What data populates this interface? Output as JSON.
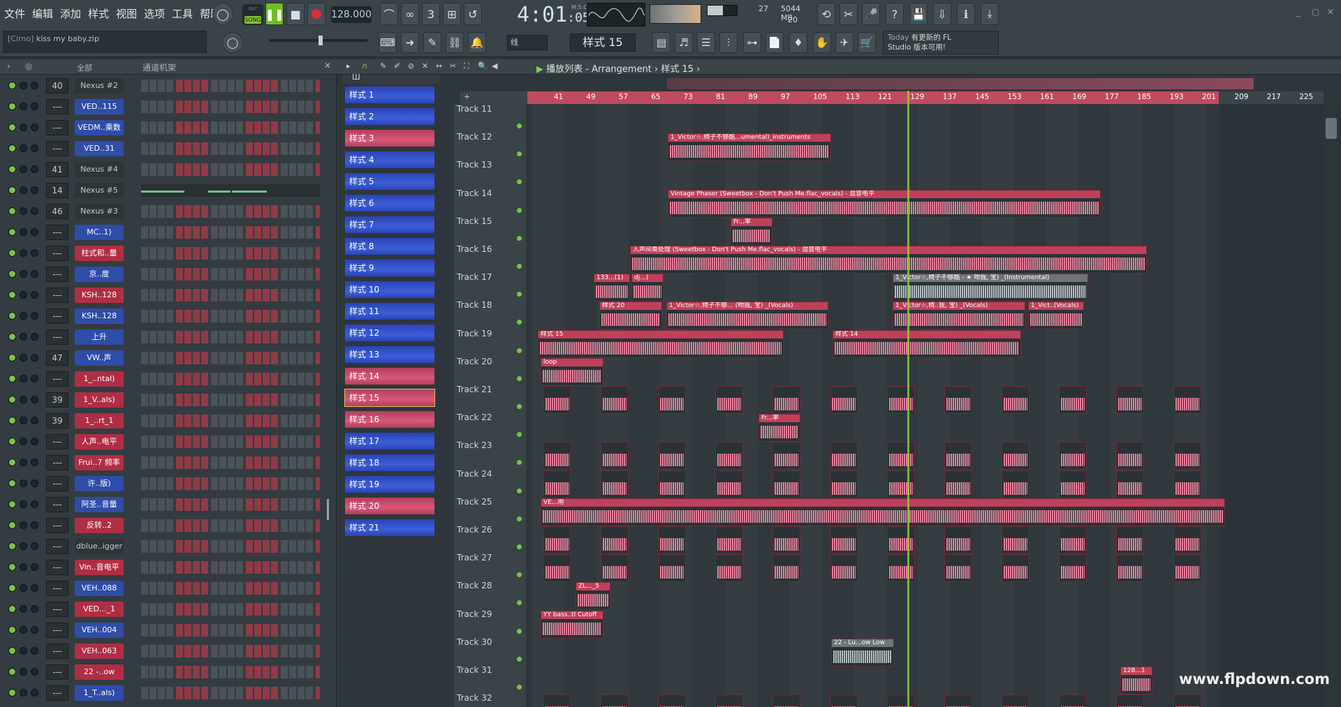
{
  "menu": [
    "文件",
    "编辑",
    "添加",
    "样式",
    "视图",
    "选项",
    "工具",
    "帮助"
  ],
  "transport": {
    "pat_label": "PAT",
    "song_label": "SONG",
    "tempo": "128.000",
    "time": "4:01",
    "time_sub": ":05",
    "time_label": "M:S:CS",
    "cpu_label": "5044 MB",
    "cpu_value": "27",
    "voices": "20"
  },
  "hint": {
    "prefix": "[Cirno]",
    "text": "kiss my baby.zip"
  },
  "news": {
    "today": "Today",
    "line1": "有更新的 FL",
    "line2": "Studio 版本可用!"
  },
  "snap_label": "线",
  "pattern_selector": "样式 15",
  "channel_rack": {
    "filter": "全部",
    "title": "通道机架"
  },
  "channels": [
    {
      "num": "40",
      "name": "Nexus #2",
      "color": "dark"
    },
    {
      "num": "---",
      "name": "VED..115",
      "color": "blue"
    },
    {
      "num": "---",
      "name": "VEDM..乘数",
      "color": "blue"
    },
    {
      "num": "---",
      "name": "VED..31",
      "color": "blue"
    },
    {
      "num": "41",
      "name": "Nexus #4",
      "color": "dark"
    },
    {
      "num": "14",
      "name": "Nexus #5",
      "color": "dark"
    },
    {
      "num": "46",
      "name": "Nexus #3",
      "color": "dark"
    },
    {
      "num": "---",
      "name": "MC..1)",
      "color": "blue"
    },
    {
      "num": "---",
      "name": "柱式和..量",
      "color": "red"
    },
    {
      "num": "---",
      "name": "京..度",
      "color": "blue"
    },
    {
      "num": "---",
      "name": "KSH..128",
      "color": "red"
    },
    {
      "num": "---",
      "name": "KSH..128",
      "color": "blue"
    },
    {
      "num": "---",
      "name": "上升",
      "color": "blue"
    },
    {
      "num": "47",
      "name": "VW..声",
      "color": "blue"
    },
    {
      "num": "---",
      "name": "1_..ntal)",
      "color": "red"
    },
    {
      "num": "39",
      "name": "1_V..als)",
      "color": "red"
    },
    {
      "num": "39",
      "name": "1_..rt_1",
      "color": "red"
    },
    {
      "num": "---",
      "name": "人声..电平",
      "color": "red"
    },
    {
      "num": "---",
      "name": "Frui..7 频率",
      "color": "red"
    },
    {
      "num": "---",
      "name": "许..版)",
      "color": "blue"
    },
    {
      "num": "---",
      "name": "阿圣..音量",
      "color": "blue"
    },
    {
      "num": "---",
      "name": "反转..2",
      "color": "red"
    },
    {
      "num": "---",
      "name": "dblue..igger",
      "color": "dark"
    },
    {
      "num": "---",
      "name": "Vin..音电平",
      "color": "red"
    },
    {
      "num": "---",
      "name": "VEH..088",
      "color": "blue"
    },
    {
      "num": "---",
      "name": "VED..._1",
      "color": "red"
    },
    {
      "num": "---",
      "name": "VEH..004",
      "color": "blue"
    },
    {
      "num": "---",
      "name": "VEH..063",
      "color": "red"
    },
    {
      "num": "---",
      "name": "22 -..ow",
      "color": "red"
    },
    {
      "num": "---",
      "name": "1_T..als)",
      "color": "blue"
    }
  ],
  "patterns": [
    {
      "label": "样式 1",
      "color": "blue"
    },
    {
      "label": "样式 2",
      "color": "blue"
    },
    {
      "label": "样式 3",
      "color": "red"
    },
    {
      "label": "样式 4",
      "color": "blue"
    },
    {
      "label": "样式 5",
      "color": "blue"
    },
    {
      "label": "样式 6",
      "color": "blue"
    },
    {
      "label": "样式 7",
      "color": "blue"
    },
    {
      "label": "样式 8",
      "color": "blue"
    },
    {
      "label": "样式 9",
      "color": "blue"
    },
    {
      "label": "样式 10",
      "color": "blue"
    },
    {
      "label": "样式 11",
      "color": "blue"
    },
    {
      "label": "样式 12",
      "color": "blue"
    },
    {
      "label": "样式 13",
      "color": "blue"
    },
    {
      "label": "样式 14",
      "color": "red"
    },
    {
      "label": "样式 15",
      "color": "red"
    },
    {
      "label": "样式 16",
      "color": "red"
    },
    {
      "label": "样式 17",
      "color": "blue"
    },
    {
      "label": "样式 18",
      "color": "blue"
    },
    {
      "label": "样式 19",
      "color": "blue"
    },
    {
      "label": "样式 20",
      "color": "red"
    },
    {
      "label": "样式 21",
      "color": "blue"
    }
  ],
  "playlist": {
    "title": "播放列表 - Arrangement",
    "crumb": "样式 15",
    "ruler_start_label": "41"
  },
  "ruler": [
    "41",
    "49",
    "57",
    "65",
    "73",
    "81",
    "89",
    "97",
    "105",
    "113",
    "121",
    "129",
    "137",
    "145",
    "153",
    "161",
    "169",
    "177",
    "185",
    "193",
    "201",
    "209",
    "217",
    "225"
  ],
  "tracks": [
    "Track 11",
    "Track 12",
    "Track 13",
    "Track 14",
    "Track 15",
    "Track 16",
    "Track 17",
    "Track 18",
    "Track 19",
    "Track 20",
    "Track 21",
    "Track 22",
    "Track 23",
    "Track 24",
    "Track 25",
    "Track 26",
    "Track 27",
    "Track 28",
    "Track 29",
    "Track 30",
    "Track 31",
    "Track 32"
  ],
  "clips": [
    {
      "track": 1,
      "label": "1_Victor☆,椅子不够酷...umental)_instruments",
      "type": "audio"
    },
    {
      "track": 3,
      "label": "Vintage Phaser (Sweetbox - Don't Push Me.flac_vocals) - 混音电平",
      "type": "auto"
    },
    {
      "track": 4,
      "label": "Fr...率",
      "type": "auto"
    },
    {
      "track": 5,
      "label": "人声间奏处理 (Sweetbox - Don't Push Me.flac_vocals) - 混音电平",
      "type": "auto"
    },
    {
      "track": 6,
      "label": "133...(1)",
      "type": "audio"
    },
    {
      "track": 6,
      "label": "dj...)",
      "type": "audio"
    },
    {
      "track": 6,
      "label": "1_Victor☆,椅子不够酷 - ★ 吻我, 宝) _(Instrumental)",
      "type": "gray"
    },
    {
      "track": 7,
      "label": "样式 20",
      "type": "pattern"
    },
    {
      "track": 7,
      "label": "1_Victor☆,椅子不够... (吻我, 宝) _(Vocals)",
      "type": "audio"
    },
    {
      "track": 7,
      "label": "1_Victor☆,椅..我, 宝) _(Vocals)",
      "type": "audio"
    },
    {
      "track": 7,
      "label": "1_Vict..(Vocals)",
      "type": "audio"
    },
    {
      "track": 8,
      "label": "样式 15",
      "type": "pattern"
    },
    {
      "track": 8,
      "label": "样式 14",
      "type": "pattern"
    },
    {
      "track": 9,
      "label": "loop",
      "type": "audio"
    },
    {
      "track": 11,
      "label": "Fr...率",
      "type": "auto"
    },
    {
      "track": 14,
      "label": "VE...用",
      "type": "audio"
    },
    {
      "track": 17,
      "label": "ZL..._5",
      "type": "audio"
    },
    {
      "track": 18,
      "label": "YY bass..tl Cutoff",
      "type": "auto"
    },
    {
      "track": 19,
      "label": "22 - Lu...ow Low",
      "type": "gray"
    },
    {
      "track": 20,
      "label": "128...1",
      "type": "audio"
    }
  ],
  "watermark": "www.flpdown.com"
}
